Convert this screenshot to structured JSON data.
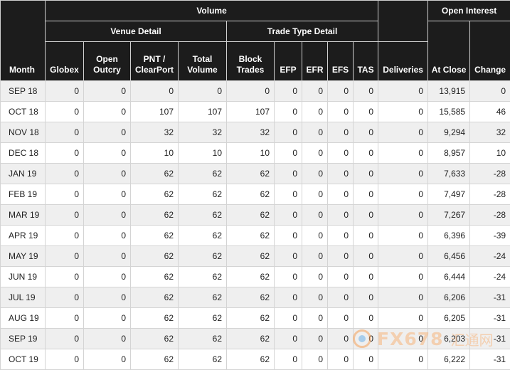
{
  "header": {
    "month": "Month",
    "volume": "Volume",
    "venue_detail": "Venue Detail",
    "trade_type_detail": "Trade Type Detail",
    "open_interest": "Open Interest",
    "globex": "Globex",
    "open_outcry": "Open Outcry",
    "pnt_clearport": "PNT / ClearPort",
    "total_volume": "Total Volume",
    "block_trades": "Block Trades",
    "efp": "EFP",
    "efr": "EFR",
    "efs": "EFS",
    "tas": "TAS",
    "deliveries": "Deliveries",
    "at_close": "At Close",
    "change": "Change"
  },
  "rows": [
    [
      "SEP 18",
      "0",
      "0",
      "0",
      "0",
      "0",
      "0",
      "0",
      "0",
      "0",
      "0",
      "13,915",
      "0"
    ],
    [
      "OCT 18",
      "0",
      "0",
      "107",
      "107",
      "107",
      "0",
      "0",
      "0",
      "0",
      "0",
      "15,585",
      "46"
    ],
    [
      "NOV 18",
      "0",
      "0",
      "32",
      "32",
      "32",
      "0",
      "0",
      "0",
      "0",
      "0",
      "9,294",
      "32"
    ],
    [
      "DEC 18",
      "0",
      "0",
      "10",
      "10",
      "10",
      "0",
      "0",
      "0",
      "0",
      "0",
      "8,957",
      "10"
    ],
    [
      "JAN 19",
      "0",
      "0",
      "62",
      "62",
      "62",
      "0",
      "0",
      "0",
      "0",
      "0",
      "7,633",
      "-28"
    ],
    [
      "FEB 19",
      "0",
      "0",
      "62",
      "62",
      "62",
      "0",
      "0",
      "0",
      "0",
      "0",
      "7,497",
      "-28"
    ],
    [
      "MAR 19",
      "0",
      "0",
      "62",
      "62",
      "62",
      "0",
      "0",
      "0",
      "0",
      "0",
      "7,267",
      "-28"
    ],
    [
      "APR 19",
      "0",
      "0",
      "62",
      "62",
      "62",
      "0",
      "0",
      "0",
      "0",
      "0",
      "6,396",
      "-39"
    ],
    [
      "MAY 19",
      "0",
      "0",
      "62",
      "62",
      "62",
      "0",
      "0",
      "0",
      "0",
      "0",
      "6,456",
      "-24"
    ],
    [
      "JUN 19",
      "0",
      "0",
      "62",
      "62",
      "62",
      "0",
      "0",
      "0",
      "0",
      "0",
      "6,444",
      "-24"
    ],
    [
      "JUL 19",
      "0",
      "0",
      "62",
      "62",
      "62",
      "0",
      "0",
      "0",
      "0",
      "0",
      "6,206",
      "-31"
    ],
    [
      "AUG 19",
      "0",
      "0",
      "62",
      "62",
      "62",
      "0",
      "0",
      "0",
      "0",
      "0",
      "6,205",
      "-31"
    ],
    [
      "SEP 19",
      "0",
      "0",
      "62",
      "62",
      "62",
      "0",
      "0",
      "0",
      "0",
      "0",
      "6,203",
      "-31"
    ],
    [
      "OCT 19",
      "0",
      "0",
      "62",
      "62",
      "62",
      "0",
      "0",
      "0",
      "0",
      "0",
      "6,222",
      "-31"
    ]
  ],
  "watermark": {
    "brand": "FX678",
    "chinese": "汇通网"
  },
  "colors": {
    "header_bg": "#1c1c1c",
    "alt_row": "#efefef",
    "border": "#d4d4d4"
  }
}
